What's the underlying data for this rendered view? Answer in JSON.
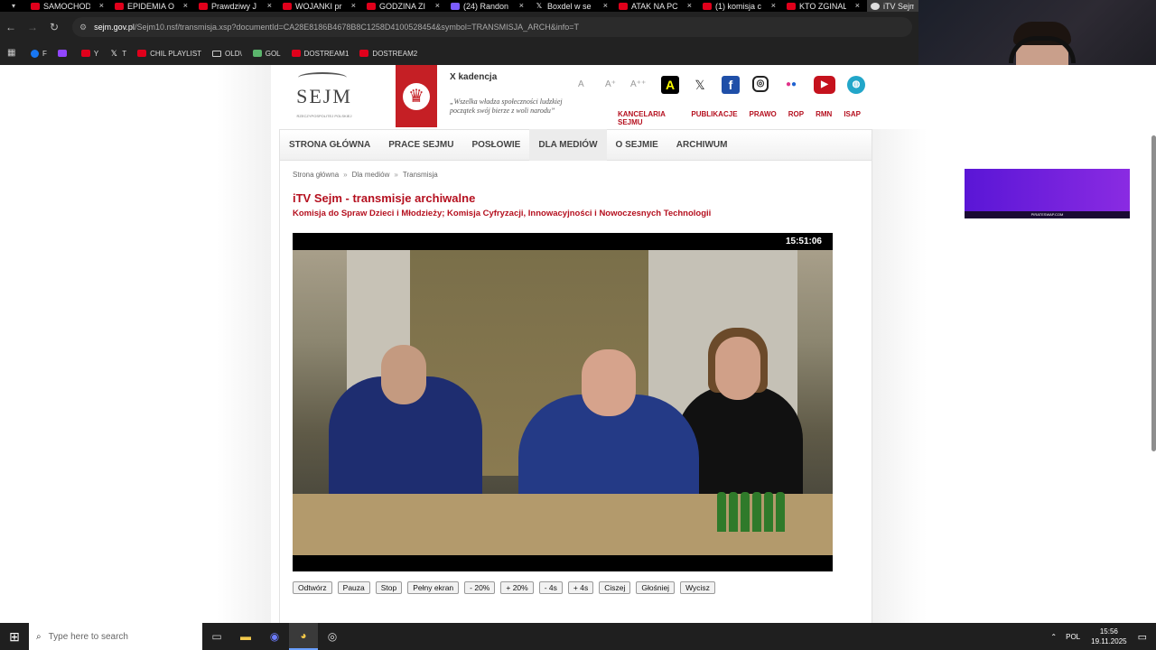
{
  "browser": {
    "tabs": [
      {
        "label": "SAMOCHOD",
        "icon": "youtube-icon"
      },
      {
        "label": "EPIDEMIA O",
        "icon": "youtube-icon"
      },
      {
        "label": "Prawdziwy J",
        "icon": "youtube-icon"
      },
      {
        "label": "WOJANKI pr",
        "icon": "youtube-icon"
      },
      {
        "label": "GODZINA ZI",
        "icon": "youtube-icon"
      },
      {
        "label": "(24) Randon",
        "icon": "twitch-icon"
      },
      {
        "label": "Boxdel w se",
        "icon": "x-icon"
      },
      {
        "label": "ATAK NA PC",
        "icon": "youtube-icon"
      },
      {
        "label": "(1) komisja c",
        "icon": "youtube-icon"
      },
      {
        "label": "KTO ZGINAL",
        "icon": "youtube-icon"
      },
      {
        "label": "iTV Sejm",
        "icon": "sejm-icon"
      }
    ],
    "url_host": "sejm.gov.pl",
    "url_rest": "/Sejm10.nsf/transmisja.xsp?documentId=CA28E8186B4678B8C1258D4100528454&symbol=TRANSMISJA_ARCH&info=T",
    "bookmarks": [
      {
        "label": "F",
        "icon": "facebook-icon"
      },
      {
        "label": "",
        "icon": "twitch-icon"
      },
      {
        "label": "Y",
        "icon": "youtube-icon"
      },
      {
        "label": "T",
        "icon": "x-icon"
      },
      {
        "label": "CHIL PLAYLIST",
        "icon": "youtube-icon"
      },
      {
        "label": "OLD\\",
        "icon": "folder-icon"
      },
      {
        "label": "GOL",
        "icon": "gol-icon"
      },
      {
        "label": "DOSTREAM1",
        "icon": "youtube-icon"
      },
      {
        "label": "DOSTREAM2",
        "icon": "youtube-icon"
      }
    ]
  },
  "header": {
    "logo_word": "SEJM",
    "logo_sub": "RZECZYPOSPOLITEJ POLSKIEJ",
    "kadencja": "X kadencja",
    "quote": "„Wszelka władza społeczności ludzkiej początek swój bierze z woli narodu”",
    "font_sizes": [
      "A",
      "A⁺",
      "A⁺⁺"
    ],
    "top_links": [
      "KANCELARIA SEJMU",
      "PUBLIKACJE",
      "PRAWO",
      "ROP",
      "RMN",
      "ISAP"
    ],
    "social": [
      "a-icon",
      "x-icon",
      "facebook-icon",
      "instagram-icon",
      "flickr-icon",
      "youtube-icon",
      "podcast-icon"
    ]
  },
  "nav": {
    "items": [
      "STRONA GŁÓWNA",
      "PRACE SEJMU",
      "POSŁOWIE",
      "DLA MEDIÓW",
      "O SEJMIE",
      "ARCHIWUM"
    ],
    "active": "DLA MEDIÓW"
  },
  "page": {
    "breadcrumbs": [
      "Strona główna",
      "Dla mediów",
      "Transmisja"
    ],
    "title": "iTV Sejm - transmisje archiwalne",
    "subtitle": "Komisja do Spraw Dzieci i Młodzieży; Komisja Cyfryzacji, Innowacyjności i Nowoczesnych Technologii",
    "video_time": "15:51:06",
    "controls": [
      "Odtwórz",
      "Pauza",
      "Stop",
      "Pełny ekran",
      "- 20%",
      "+ 20%",
      "- 4s",
      "+ 4s",
      "Ciszej",
      "Głośniej",
      "Wycisz"
    ]
  },
  "ad": {
    "strip_text": "PIRATESWAP.COM"
  },
  "taskbar": {
    "search_placeholder": "Type here to search",
    "lang": "POL",
    "time": "15:56",
    "date": "19.11.2025"
  },
  "colors": {
    "sejm_red": "#b5101f",
    "flag_red": "#c51f25"
  }
}
